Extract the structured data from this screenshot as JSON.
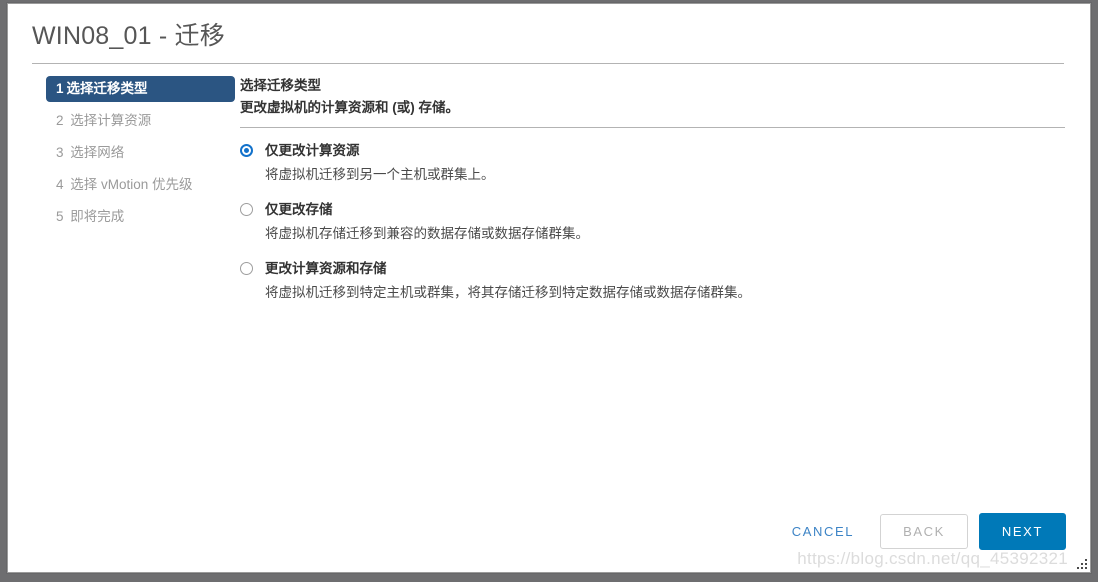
{
  "window": {
    "title": "WIN08_01 - 迁移"
  },
  "wizard": {
    "steps": [
      {
        "num": "1",
        "label": "选择迁移类型",
        "active": true
      },
      {
        "num": "2",
        "label": "选择计算资源",
        "active": false
      },
      {
        "num": "3",
        "label": "选择网络",
        "active": false
      },
      {
        "num": "4",
        "label": "选择 vMotion 优先级",
        "active": false
      },
      {
        "num": "5",
        "label": "即将完成",
        "active": false
      }
    ]
  },
  "content": {
    "title": "选择迁移类型",
    "subtitle": "更改虚拟机的计算资源和 (或) 存储。",
    "options": [
      {
        "label": "仅更改计算资源",
        "desc": "将虚拟机迁移到另一个主机或群集上。",
        "selected": true
      },
      {
        "label": "仅更改存储",
        "desc": "将虚拟机存储迁移到兼容的数据存储或数据存储群集。",
        "selected": false
      },
      {
        "label": "更改计算资源和存储",
        "desc": "将虚拟机迁移到特定主机或群集，将其存储迁移到特定数据存储或数据存储群集。",
        "selected": false
      }
    ]
  },
  "footer": {
    "cancel_label": "CANCEL",
    "back_label": "BACK",
    "next_label": "NEXT"
  },
  "watermark": {
    "text": "https://blog.csdn.net/qq_45392321"
  },
  "colors": {
    "accent_blue": "#0079b8",
    "step_active_bg": "#2b5582",
    "link_blue": "#3d84c6",
    "radio_blue": "#1372cb"
  }
}
